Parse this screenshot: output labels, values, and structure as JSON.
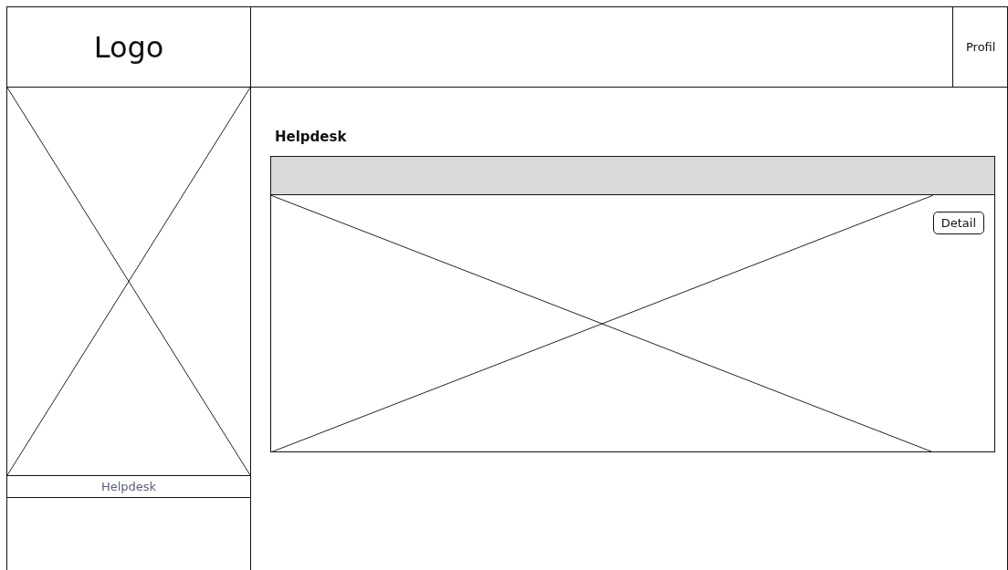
{
  "logo": "Logo",
  "header": {
    "profile": "Profil"
  },
  "sidebar": {
    "items": [
      {
        "label": "Helpdesk"
      }
    ]
  },
  "main": {
    "title": "Helpdesk",
    "table": {
      "button": "Detail"
    }
  }
}
